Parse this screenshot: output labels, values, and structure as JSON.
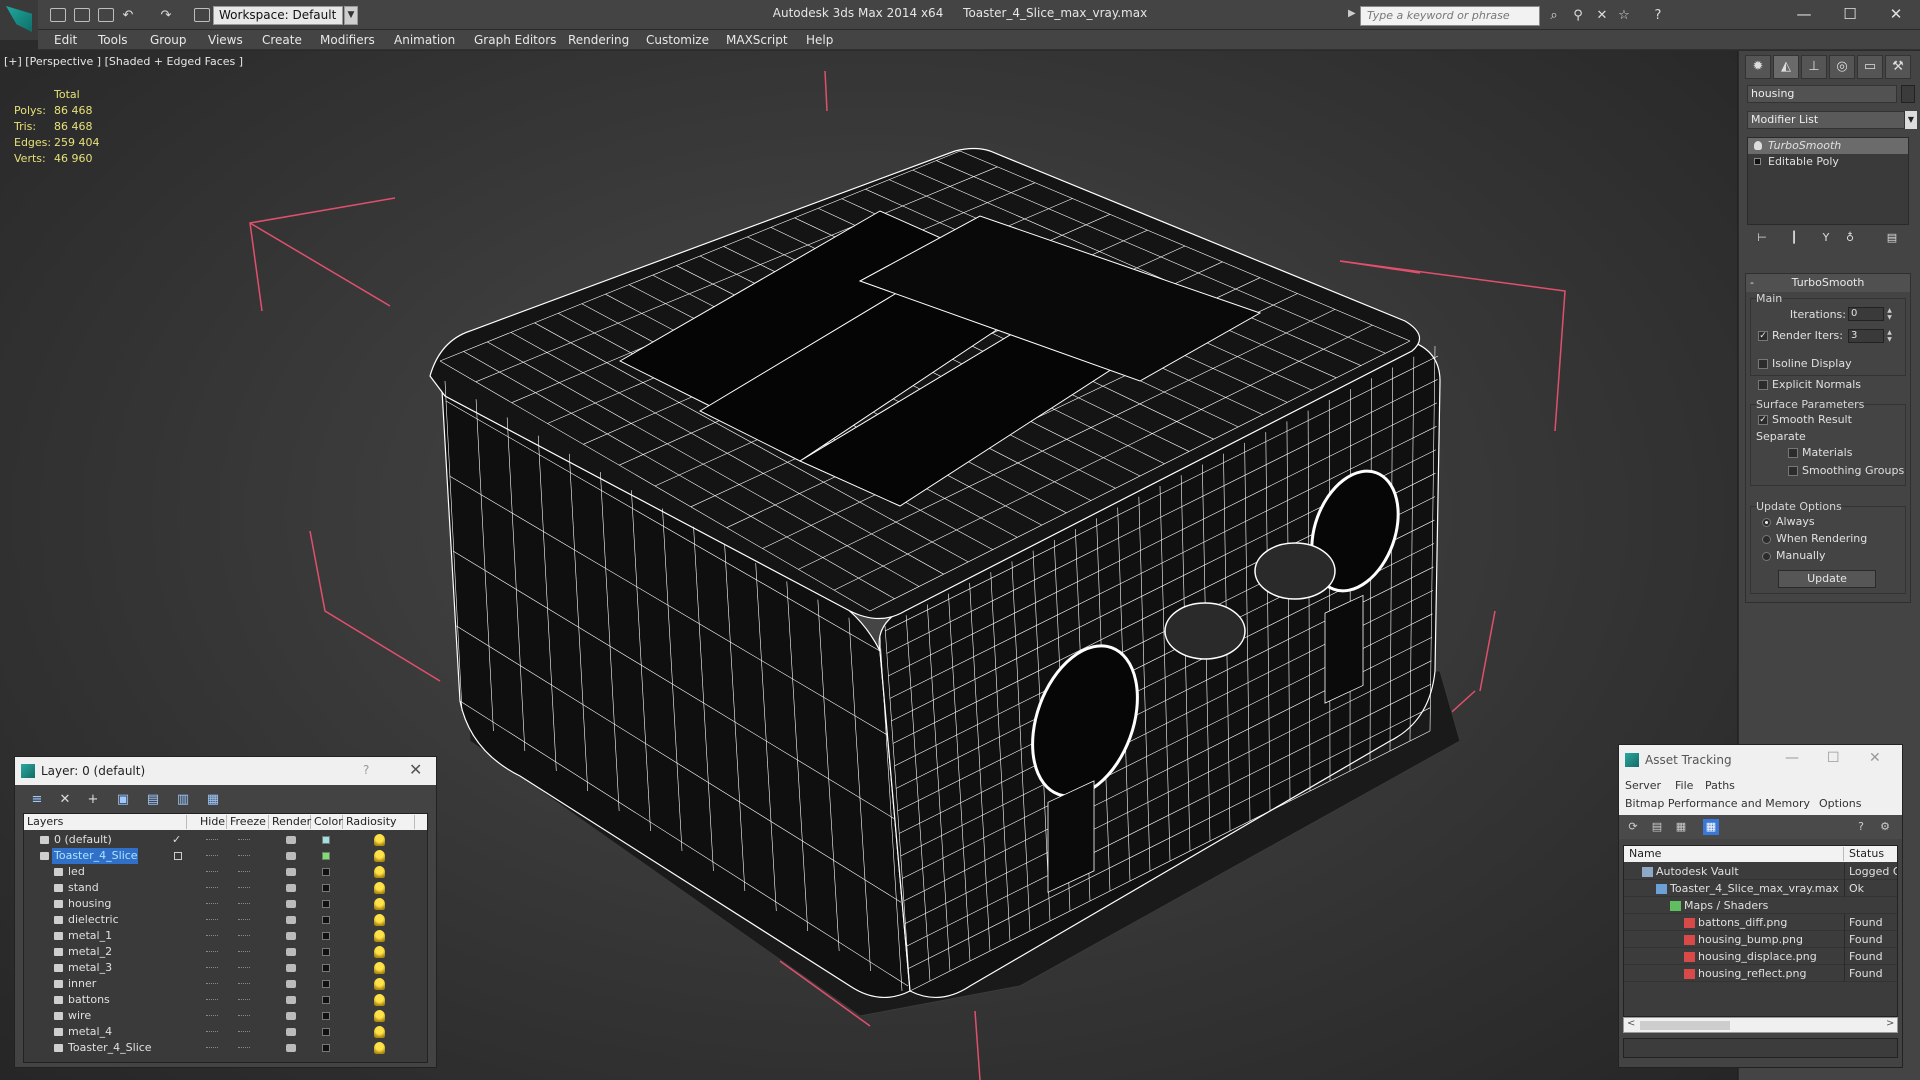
{
  "window": {
    "app_title": "Autodesk 3ds Max 2014 x64",
    "file_name": "Toaster_4_Slice_max_vray.max",
    "workspace_label": "Workspace: Default",
    "search_placeholder": "Type a keyword or phrase"
  },
  "menu": [
    "Edit",
    "Tools",
    "Group",
    "Views",
    "Create",
    "Modifiers",
    "Animation",
    "Graph Editors",
    "Rendering",
    "Customize",
    "MAXScript",
    "Help"
  ],
  "viewport": {
    "label": "[+] [Perspective ] [Shaded + Edged Faces ]",
    "stats_header": "Total",
    "stats": [
      {
        "label": "Polys:",
        "value": "86 468"
      },
      {
        "label": "Tris:",
        "value": "86 468"
      },
      {
        "label": "Edges:",
        "value": "259 404"
      },
      {
        "label": "Verts:",
        "value": "46 960"
      }
    ],
    "colors": {
      "wire": "#ffffff",
      "mesh": "#0d0d0d",
      "bbox": "#e0506e"
    }
  },
  "command_panel": {
    "object_name": "housing",
    "modifier_list_label": "Modifier List",
    "stack": [
      {
        "label": "TurboSmooth",
        "selected": true
      },
      {
        "label": "Editable Poly",
        "selected": false
      }
    ],
    "turbosmooth": {
      "title": "TurboSmooth",
      "main_label": "Main",
      "iterations_label": "Iterations:",
      "iterations_value": "0",
      "render_iters_label": "Render Iters:",
      "render_iters_value": "3",
      "isoline_label": "Isoline Display",
      "explicit_normals_label": "Explicit Normals",
      "surface_params_label": "Surface Parameters",
      "smooth_result_label": "Smooth Result",
      "separate_label": "Separate",
      "materials_label": "Materials",
      "smoothing_groups_label": "Smoothing Groups",
      "update_options_label": "Update Options",
      "always_label": "Always",
      "when_rendering_label": "When Rendering",
      "manually_label": "Manually",
      "update_button": "Update"
    }
  },
  "layer_dialog": {
    "title": "Layer: 0 (default)",
    "help": "?",
    "columns": [
      "Layers",
      "Hide",
      "Freeze",
      "Render",
      "Color",
      "Radiosity"
    ],
    "rows": [
      {
        "name": "0 (default)",
        "level": 0,
        "selected": false,
        "color": "#9fe0e0",
        "active": true
      },
      {
        "name": "Toaster_4_Slice",
        "level": 0,
        "selected": true,
        "color": "#79e06a",
        "active": false
      },
      {
        "name": "led",
        "level": 1,
        "selected": false,
        "color": "#111111",
        "active": false
      },
      {
        "name": "stand",
        "level": 1,
        "selected": false,
        "color": "#111111",
        "active": false
      },
      {
        "name": "housing",
        "level": 1,
        "selected": false,
        "color": "#111111",
        "active": false
      },
      {
        "name": "dielectric",
        "level": 1,
        "selected": false,
        "color": "#111111",
        "active": false
      },
      {
        "name": "metal_1",
        "level": 1,
        "selected": false,
        "color": "#111111",
        "active": false
      },
      {
        "name": "metal_2",
        "level": 1,
        "selected": false,
        "color": "#111111",
        "active": false
      },
      {
        "name": "metal_3",
        "level": 1,
        "selected": false,
        "color": "#111111",
        "active": false
      },
      {
        "name": "inner",
        "level": 1,
        "selected": false,
        "color": "#111111",
        "active": false
      },
      {
        "name": "battons",
        "level": 1,
        "selected": false,
        "color": "#111111",
        "active": false
      },
      {
        "name": "wire",
        "level": 1,
        "selected": false,
        "color": "#111111",
        "active": false
      },
      {
        "name": "metal_4",
        "level": 1,
        "selected": false,
        "color": "#111111",
        "active": false
      },
      {
        "name": "Toaster_4_Slice",
        "level": 1,
        "selected": false,
        "color": "#111111",
        "active": false
      }
    ]
  },
  "asset_dialog": {
    "title": "Asset Tracking",
    "menu_row1": [
      "Server",
      "File",
      "Paths"
    ],
    "menu_row2": [
      "Bitmap Performance and Memory",
      "Options"
    ],
    "columns": [
      "Name",
      "Status"
    ],
    "rows": [
      {
        "name": "Autodesk Vault",
        "status": "Logged Out",
        "level": 0,
        "icon": "vault"
      },
      {
        "name": "Toaster_4_Slice_max_vray.max",
        "status": "Ok",
        "level": 1,
        "icon": "file"
      },
      {
        "name": "Maps / Shaders",
        "status": "",
        "level": 2,
        "icon": "maps"
      },
      {
        "name": "battons_diff.png",
        "status": "Found",
        "level": 3,
        "icon": "png"
      },
      {
        "name": "housing_bump.png",
        "status": "Found",
        "level": 3,
        "icon": "png"
      },
      {
        "name": "housing_displace.png",
        "status": "Found",
        "level": 3,
        "icon": "png"
      },
      {
        "name": "housing_reflect.png",
        "status": "Found",
        "level": 3,
        "icon": "png"
      }
    ]
  }
}
